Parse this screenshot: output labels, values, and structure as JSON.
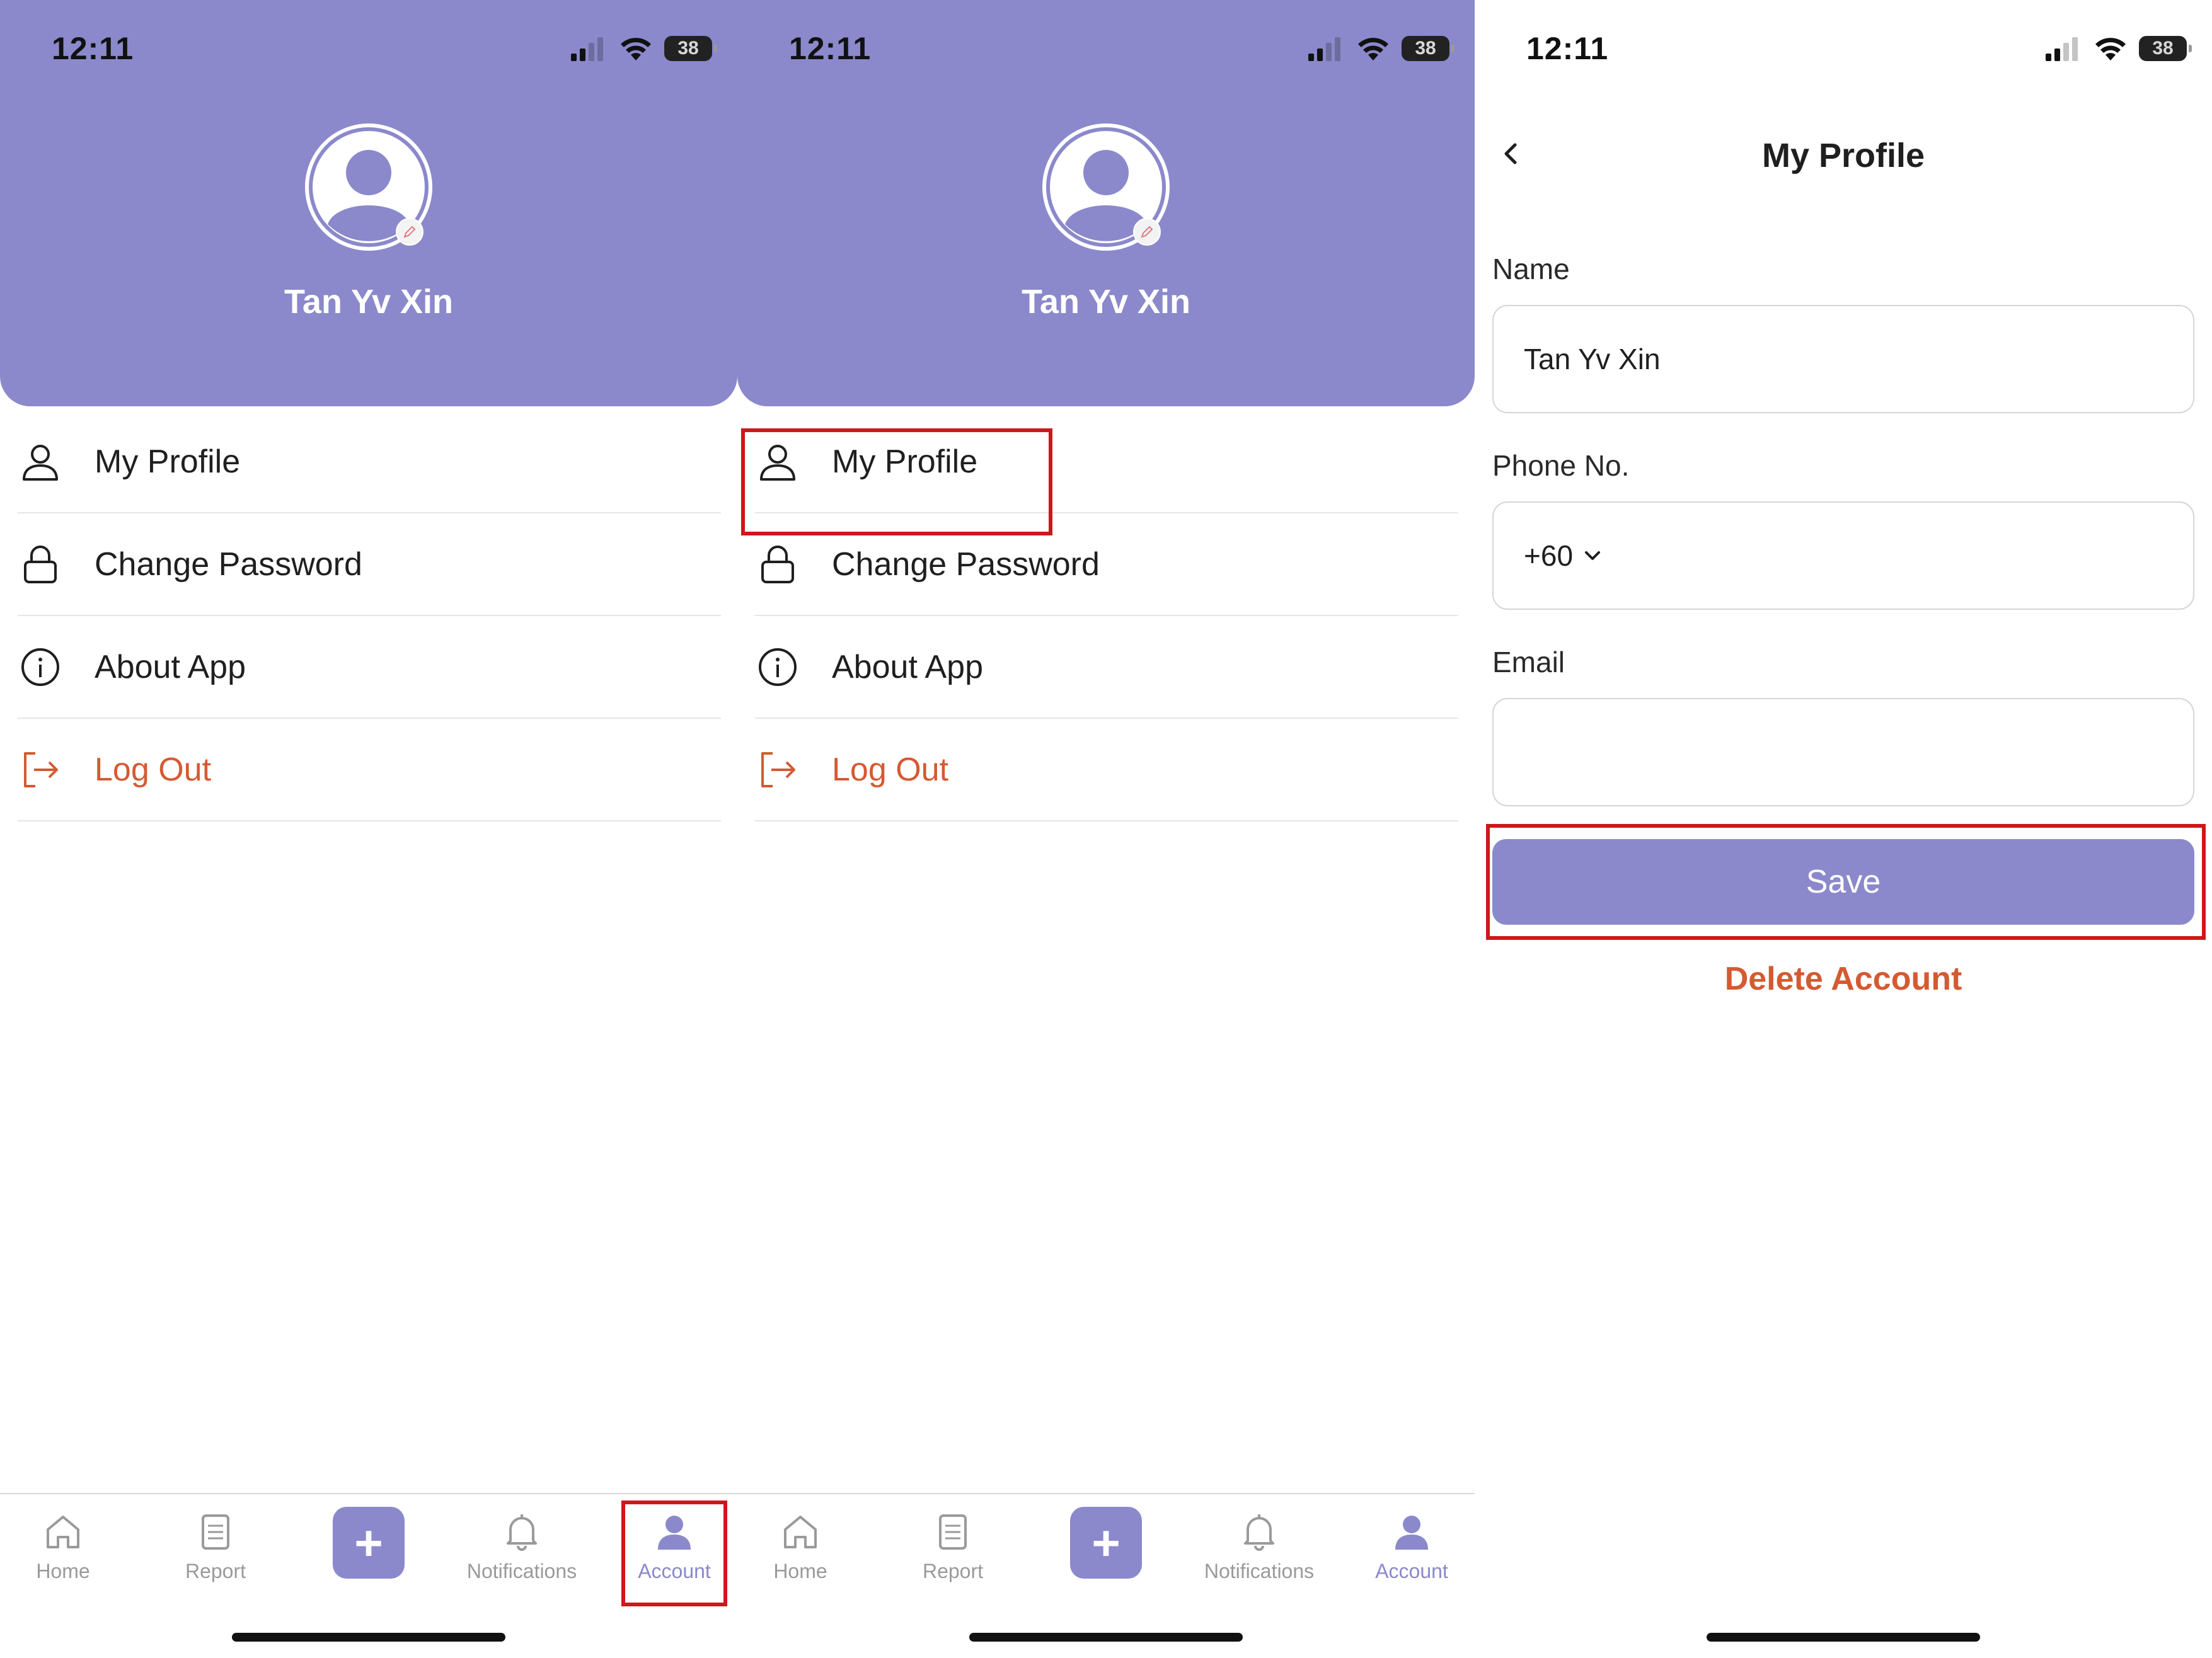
{
  "status_bar": {
    "time": "12:11",
    "battery": "38"
  },
  "user": {
    "name": "Tan Yv Xin"
  },
  "menu": {
    "items": [
      {
        "label": "My Profile",
        "icon": "user-icon"
      },
      {
        "label": "Change Password",
        "icon": "lock-icon"
      },
      {
        "label": "About App",
        "icon": "info-icon"
      },
      {
        "label": "Log Out",
        "icon": "logout-icon"
      }
    ]
  },
  "bottom_nav": {
    "items": [
      {
        "label": "Home",
        "icon": "home-icon"
      },
      {
        "label": "Report",
        "icon": "report-icon"
      },
      {
        "label": "+",
        "icon": "plus-icon"
      },
      {
        "label": "Notifications",
        "icon": "bell-icon"
      },
      {
        "label": "Account",
        "icon": "account-icon"
      }
    ],
    "active": "Account"
  },
  "profile_form": {
    "title": "My Profile",
    "name_label": "Name",
    "name_value": "Tan Yv Xin",
    "phone_label": "Phone No.",
    "country_code": "+60",
    "email_label": "Email",
    "email_value": "",
    "save_label": "Save",
    "delete_label": "Delete Account"
  },
  "colors": {
    "brand": "#8b89cb",
    "danger": "#d45a32",
    "highlight": "#d0161b"
  }
}
